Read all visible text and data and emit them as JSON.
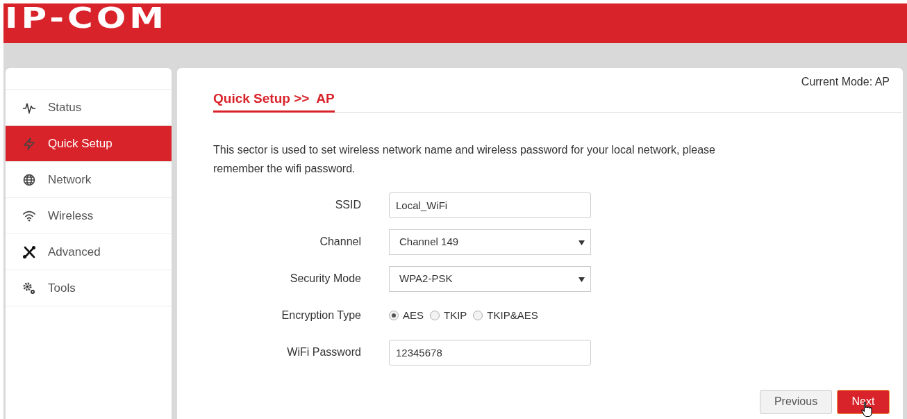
{
  "logo": "IP-COM",
  "sidebar": {
    "items": [
      {
        "label": "Status",
        "selected": false
      },
      {
        "label": "Quick Setup",
        "selected": true
      },
      {
        "label": "Network",
        "selected": false
      },
      {
        "label": "Wireless",
        "selected": false
      },
      {
        "label": "Advanced",
        "selected": false
      },
      {
        "label": "Tools",
        "selected": false
      }
    ]
  },
  "current_mode": "Current Mode: AP",
  "title": "Quick Setup >>  AP",
  "description": "This sector is used to set wireless network name and wireless password for your local network, please remember the wifi password.",
  "form": [
    {
      "kind": "text",
      "label": "SSID",
      "value": "Local_WiFi"
    },
    {
      "kind": "select",
      "label": "Channel",
      "value": "Channel 149"
    },
    {
      "kind": "select",
      "label": "Security Mode",
      "value": "WPA2-PSK"
    },
    {
      "kind": "radio",
      "label": "Encryption Type",
      "options": [
        {
          "label": "AES",
          "selected": true
        },
        {
          "label": "TKIP",
          "selected": false
        },
        {
          "label": "TKIP&AES",
          "selected": false
        }
      ]
    },
    {
      "kind": "text",
      "label": "WiFi Password",
      "value": "12345678"
    }
  ],
  "buttons": [
    {
      "label": "Previous",
      "kind": "secondary"
    },
    {
      "label": "Next",
      "kind": "primary"
    }
  ]
}
